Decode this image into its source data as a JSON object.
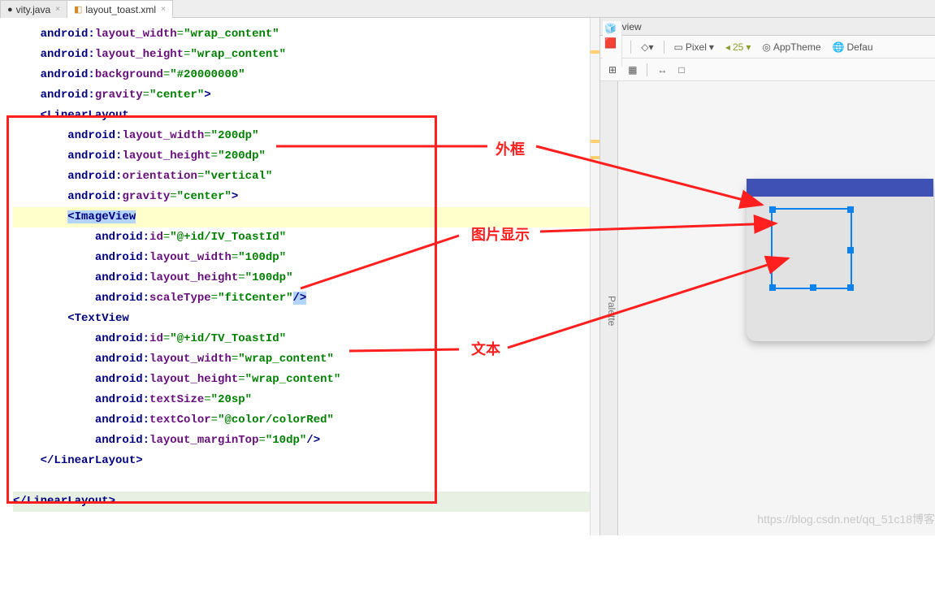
{
  "tabs": [
    {
      "label": "vity.java",
      "icon_color": "#3b9bff"
    },
    {
      "label": "layout_toast.xml",
      "icon_color": "#d38a2b"
    }
  ],
  "preview": {
    "title": "Preview",
    "palette_label": "Palette",
    "device_label": "Pixel",
    "api_label": "25",
    "theme_label": "AppTheme",
    "more_label": "Defau"
  },
  "annotations": {
    "outer": "外框",
    "image": "图片显示",
    "text": "文本"
  },
  "code": {
    "l1_ns": "android:",
    "l1_att": "layout_width",
    "l1_val": "\"wrap_content\"",
    "l2_ns": "android:",
    "l2_att": "layout_height",
    "l2_val": "\"wrap_content\"",
    "l3_ns": "android:",
    "l3_att": "background",
    "l3_val": "\"#20000000\"",
    "l4_ns": "android:",
    "l4_att": "gravity",
    "l4_val": "\"center\"",
    "l4_close": ">",
    "ll_open": "LinearLayout",
    "ll1_ns": "android:",
    "ll1_att": "layout_width",
    "ll1_val": "\"200dp\"",
    "ll2_ns": "android:",
    "ll2_att": "layout_height",
    "ll2_val": "\"200dp\"",
    "ll3_ns": "android:",
    "ll3_att": "orientation",
    "ll3_val": "\"vertical\"",
    "ll4_ns": "android:",
    "ll4_att": "gravity",
    "ll4_val": "\"center\"",
    "ll4_close": ">",
    "iv_open": "ImageView",
    "iv1_ns": "android:",
    "iv1_att": "id",
    "iv1_val": "\"@+id/IV_ToastId\"",
    "iv2_ns": "android:",
    "iv2_att": "layout_width",
    "iv2_val": "\"100dp\"",
    "iv3_ns": "android:",
    "iv3_att": "layout_height",
    "iv3_val": "\"100dp\"",
    "iv4_ns": "android:",
    "iv4_att": "scaleType",
    "iv4_val": "\"fitCenter\"",
    "iv4_close": "/>",
    "tv_open": "TextView",
    "tv1_ns": "android:",
    "tv1_att": "id",
    "tv1_val": "\"@+id/TV_ToastId\"",
    "tv2_ns": "android:",
    "tv2_att": "layout_width",
    "tv2_val": "\"wrap_content\"",
    "tv3_ns": "android:",
    "tv3_att": "layout_height",
    "tv3_val": "\"wrap_content\"",
    "tv4_ns": "android:",
    "tv4_att": "textSize",
    "tv4_val": "\"20sp\"",
    "tv5_ns": "android:",
    "tv5_att": "textColor",
    "tv5_val": "\"@color/colorRed\"",
    "tv6_ns": "android:",
    "tv6_att": "layout_marginTop",
    "tv6_val": "\"10dp\"",
    "tv6_close": "/>",
    "ll_close": "LinearLayout",
    "root_close": "LinearLayout"
  },
  "watermark": "https://blog.csdn.net/qq_51c18博客"
}
